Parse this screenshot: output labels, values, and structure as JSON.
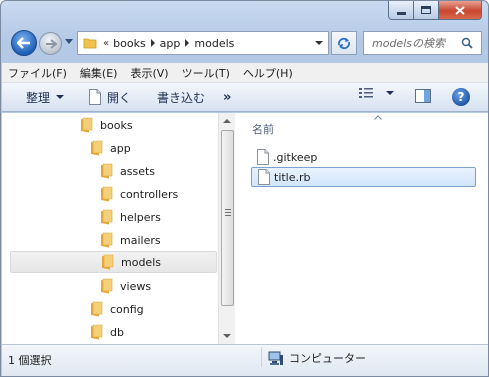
{
  "window": {
    "title": ""
  },
  "address": {
    "overflow": "«",
    "crumbs": [
      "books",
      "app",
      "models"
    ]
  },
  "search": {
    "placeholder": "modelsの検索"
  },
  "menu": [
    "ファイル(F)",
    "編集(E)",
    "表示(V)",
    "ツール(T)",
    "ヘルプ(H)"
  ],
  "commands": {
    "organize": "整理",
    "open": "開く",
    "print": "書き込む",
    "more": "»",
    "help": "?"
  },
  "tree": [
    {
      "label": "books",
      "level": 1
    },
    {
      "label": "app",
      "level": 2
    },
    {
      "label": "assets",
      "level": 3
    },
    {
      "label": "controllers",
      "level": 3
    },
    {
      "label": "helpers",
      "level": 3
    },
    {
      "label": "mailers",
      "level": 3
    },
    {
      "label": "models",
      "level": 3,
      "selected": true
    },
    {
      "label": "views",
      "level": 3
    },
    {
      "label": "config",
      "level": 2
    },
    {
      "label": "db",
      "level": 2
    }
  ],
  "files": {
    "column_name": "名前",
    "items": [
      {
        "name": ".gitkeep",
        "selected": false
      },
      {
        "name": "title.rb",
        "selected": true
      }
    ]
  },
  "status": {
    "selection": "1 個選択",
    "location": "コンピューター"
  },
  "colors": {
    "accent": "#1e5fb8",
    "folder": "#f1c24d",
    "selection": "#d2e5fb"
  }
}
